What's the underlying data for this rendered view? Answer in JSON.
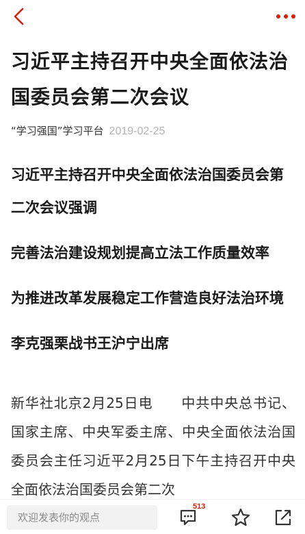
{
  "article": {
    "title": "习近平主持召开中央全面依法治国委员会第二次会议",
    "source": "“学习强国”学习平台",
    "date": "2019-02-25",
    "subheads": [
      "习近平主持召开中央全面依法治国委员会第二次会议强调",
      "完善法治建设规划提高立法工作质量效率",
      "为推进改革发展稳定工作营造良好法治环境",
      "李克强栗战书王沪宁出席"
    ],
    "body": "新华社北京2月25日电　　中共中央总书记、国家主席、中央军委主席、中央全面依法治国委员会主任习近平2月25日下午主持召开中央全面依法治国委员会第二次"
  },
  "bottom_bar": {
    "comment_placeholder": "欢迎发表你的观点",
    "comment_count": "513"
  },
  "icons": {
    "back": "chevron-left-icon",
    "more": "more-dots-icon",
    "comments": "comment-icon",
    "favorite": "star-icon",
    "share": "share-icon"
  },
  "colors": {
    "accent": "#d81e06",
    "date": "#b3b3b3",
    "input_bg": "#f2f2f2"
  }
}
